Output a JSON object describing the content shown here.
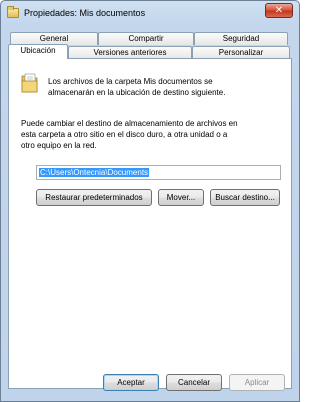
{
  "window": {
    "title": "Propiedades: Mis documentos",
    "close_label": "✕"
  },
  "tabs": {
    "row1": [
      {
        "label": "General"
      },
      {
        "label": "Compartir"
      },
      {
        "label": "Seguridad"
      }
    ],
    "row2": [
      {
        "label": "Ubicación",
        "selected": true
      },
      {
        "label": "Versiones anteriores"
      },
      {
        "label": "Personalizar"
      }
    ]
  },
  "location_tab": {
    "folder_icon": "folder-icon",
    "description_line1": "Los archivos de la carpeta Mis documentos se",
    "description_line2": "almacenarán en la ubicación de destino siguiente.",
    "info_line1": "Puede cambiar el destino de almacenamiento de archivos en",
    "info_line2": "esta carpeta a otro sitio en el disco duro, a otra unidad o a",
    "info_line3": "otro equipo en la red.",
    "path_value": "C:\\Users\\Ontecnia\\Documents",
    "restore_button": "Restaurar predeterminados",
    "move_button": "Mover...",
    "find_button": "Buscar destino..."
  },
  "footer": {
    "accept_button": "Aceptar",
    "cancel_button": "Cancelar",
    "apply_button": "Aplicar"
  },
  "colors": {
    "frame": "#bfd3ea",
    "selection": "#3399ff",
    "close_button": "#c2391f"
  }
}
